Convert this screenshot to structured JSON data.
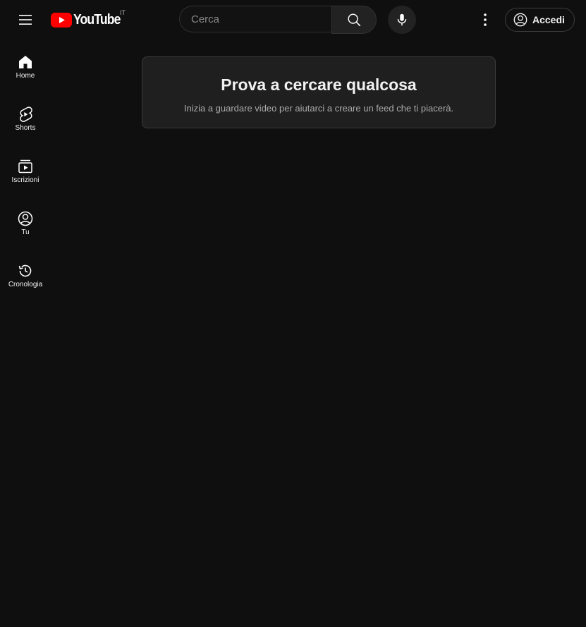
{
  "header": {
    "logo_text": "YouTube",
    "country_code": "IT",
    "search_placeholder": "Cerca",
    "signin_label": "Accedi"
  },
  "sidebar": {
    "items": [
      {
        "label": "Home",
        "icon": "home-icon"
      },
      {
        "label": "Shorts",
        "icon": "shorts-icon"
      },
      {
        "label": "Iscrizioni",
        "icon": "subscriptions-icon"
      },
      {
        "label": "Tu",
        "icon": "account-icon"
      },
      {
        "label": "Cronologia",
        "icon": "history-icon"
      }
    ]
  },
  "main": {
    "title": "Prova a cercare qualcosa",
    "subtitle": "Inizia a guardare video per aiutarci a creare un feed che ti piacerà."
  },
  "colors": {
    "background": "#0f0f0f",
    "brand_red": "#ff0000",
    "card_bg": "#1f1f1f",
    "text": "#f1f1f1",
    "muted_text": "#aaaaaa"
  }
}
